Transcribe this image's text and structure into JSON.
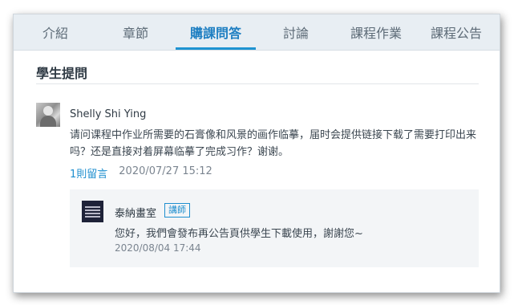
{
  "tabs": [
    {
      "label": "介紹",
      "active": false
    },
    {
      "label": "章節",
      "active": false
    },
    {
      "label": "購課問答",
      "active": true
    },
    {
      "label": "討論",
      "active": false
    },
    {
      "label": "課程作業",
      "active": false
    },
    {
      "label": "課程公告",
      "active": false
    }
  ],
  "section": {
    "title": "學生提問"
  },
  "question": {
    "author": "Shelly Shi Ying",
    "avatar_icon": "user-photo",
    "body": "请问课程中作业所需要的石膏像和风景的画作临摹，届时会提供链接下载了需要打印出来吗？还是直接对着屏幕临摹了完成习作？谢谢。",
    "reply_count_label": "1則留言",
    "timestamp": "2020/07/27 15:12"
  },
  "reply": {
    "author": "泰納畫室",
    "badge": "講師",
    "logo_icon": "studio-logo",
    "body": "您好，我們會發布再公告頁供學生下載使用，謝謝您~",
    "timestamp": "2020/08/04 17:44"
  },
  "colors": {
    "accent": "#1f8fcf",
    "tab_bar_bg": "#e8eef3",
    "reply_bg": "#f3f5f7"
  }
}
